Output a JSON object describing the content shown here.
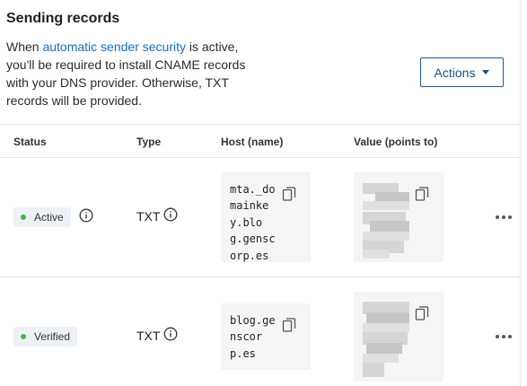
{
  "section": {
    "title": "Sending records",
    "desc_prefix": "When ",
    "desc_link": "automatic sender security",
    "desc_suffix": " is active, you'll be required to install CNAME records with your DNS provider. Otherwise, TXT records will be provided.",
    "actions_label": "Actions"
  },
  "table": {
    "headers": {
      "status": "Status",
      "type": "Type",
      "host": "Host (name)",
      "value": "Value (points to)"
    },
    "rows": [
      {
        "status": "Active",
        "type": "TXT",
        "host": "mta._do\nmainke\ny.blo\ng.gensc\norp.es"
      },
      {
        "status": "Verified",
        "type": "TXT",
        "host": "blog.ge\nnscor\np.es"
      }
    ]
  },
  "colors": {
    "accent": "#1270c3",
    "status_ok": "#45b945"
  }
}
